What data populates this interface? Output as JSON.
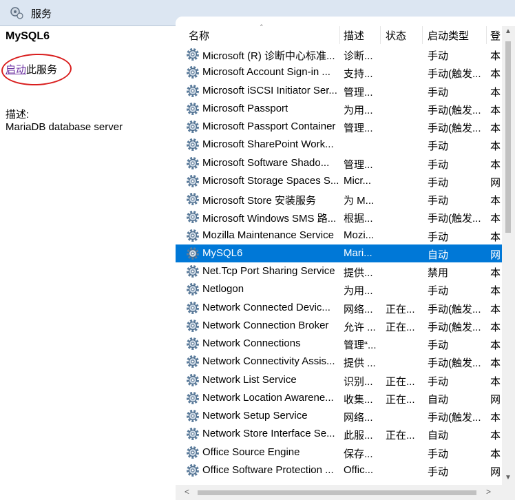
{
  "window": {
    "title": "服务"
  },
  "left": {
    "service_name": "MySQL6",
    "start_link": "启动",
    "start_suffix": "此服务",
    "desc_label": "描述:",
    "desc_text": "MariaDB database server"
  },
  "columns": {
    "name": "名称",
    "desc": "描述",
    "status": "状态",
    "start": "启动类型",
    "logon": "登"
  },
  "selected_index": 11,
  "rows": [
    {
      "name": "Microsoft (R) 诊断中心标准...",
      "desc": "诊断...",
      "status": "",
      "start": "手动",
      "logon": "本"
    },
    {
      "name": "Microsoft Account Sign-in ...",
      "desc": "支持...",
      "status": "",
      "start": "手动(触发...",
      "logon": "本"
    },
    {
      "name": "Microsoft iSCSI Initiator Ser...",
      "desc": "管理...",
      "status": "",
      "start": "手动",
      "logon": "本"
    },
    {
      "name": "Microsoft Passport",
      "desc": "为用...",
      "status": "",
      "start": "手动(触发...",
      "logon": "本"
    },
    {
      "name": "Microsoft Passport Container",
      "desc": "管理...",
      "status": "",
      "start": "手动(触发...",
      "logon": "本"
    },
    {
      "name": "Microsoft SharePoint Work...",
      "desc": "",
      "status": "",
      "start": "手动",
      "logon": "本"
    },
    {
      "name": "Microsoft Software Shado...",
      "desc": "管理...",
      "status": "",
      "start": "手动",
      "logon": "本"
    },
    {
      "name": "Microsoft Storage Spaces S...",
      "desc": "Micr...",
      "status": "",
      "start": "手动",
      "logon": "网"
    },
    {
      "name": "Microsoft Store 安装服务",
      "desc": "为 M...",
      "status": "",
      "start": "手动",
      "logon": "本"
    },
    {
      "name": "Microsoft Windows SMS 路...",
      "desc": "根据...",
      "status": "",
      "start": "手动(触发...",
      "logon": "本"
    },
    {
      "name": "Mozilla Maintenance Service",
      "desc": "Mozi...",
      "status": "",
      "start": "手动",
      "logon": "本"
    },
    {
      "name": "MySQL6",
      "desc": "Mari...",
      "status": "",
      "start": "自动",
      "logon": "网"
    },
    {
      "name": "Net.Tcp Port Sharing Service",
      "desc": "提供...",
      "status": "",
      "start": "禁用",
      "logon": "本"
    },
    {
      "name": "Netlogon",
      "desc": "为用...",
      "status": "",
      "start": "手动",
      "logon": "本"
    },
    {
      "name": "Network Connected Devic...",
      "desc": "网络...",
      "status": "正在...",
      "start": "手动(触发...",
      "logon": "本"
    },
    {
      "name": "Network Connection Broker",
      "desc": "允许 ...",
      "status": "正在...",
      "start": "手动(触发...",
      "logon": "本"
    },
    {
      "name": "Network Connections",
      "desc": "管理“...",
      "status": "",
      "start": "手动",
      "logon": "本"
    },
    {
      "name": "Network Connectivity Assis...",
      "desc": "提供 ...",
      "status": "",
      "start": "手动(触发...",
      "logon": "本"
    },
    {
      "name": "Network List Service",
      "desc": "识别...",
      "status": "正在...",
      "start": "手动",
      "logon": "本"
    },
    {
      "name": "Network Location Awarene...",
      "desc": "收集...",
      "status": "正在...",
      "start": "自动",
      "logon": "网"
    },
    {
      "name": "Network Setup Service",
      "desc": "网络...",
      "status": "",
      "start": "手动(触发...",
      "logon": "本"
    },
    {
      "name": "Network Store Interface Se...",
      "desc": "此服...",
      "status": "正在...",
      "start": "自动",
      "logon": "本"
    },
    {
      "name": "Office  Source Engine",
      "desc": "保存...",
      "status": "",
      "start": "手动",
      "logon": "本"
    },
    {
      "name": "Office Software Protection ...",
      "desc": "Offic...",
      "status": "",
      "start": "手动",
      "logon": "网"
    }
  ],
  "icons": {
    "title": "services-icon",
    "row": "gear-icon"
  }
}
